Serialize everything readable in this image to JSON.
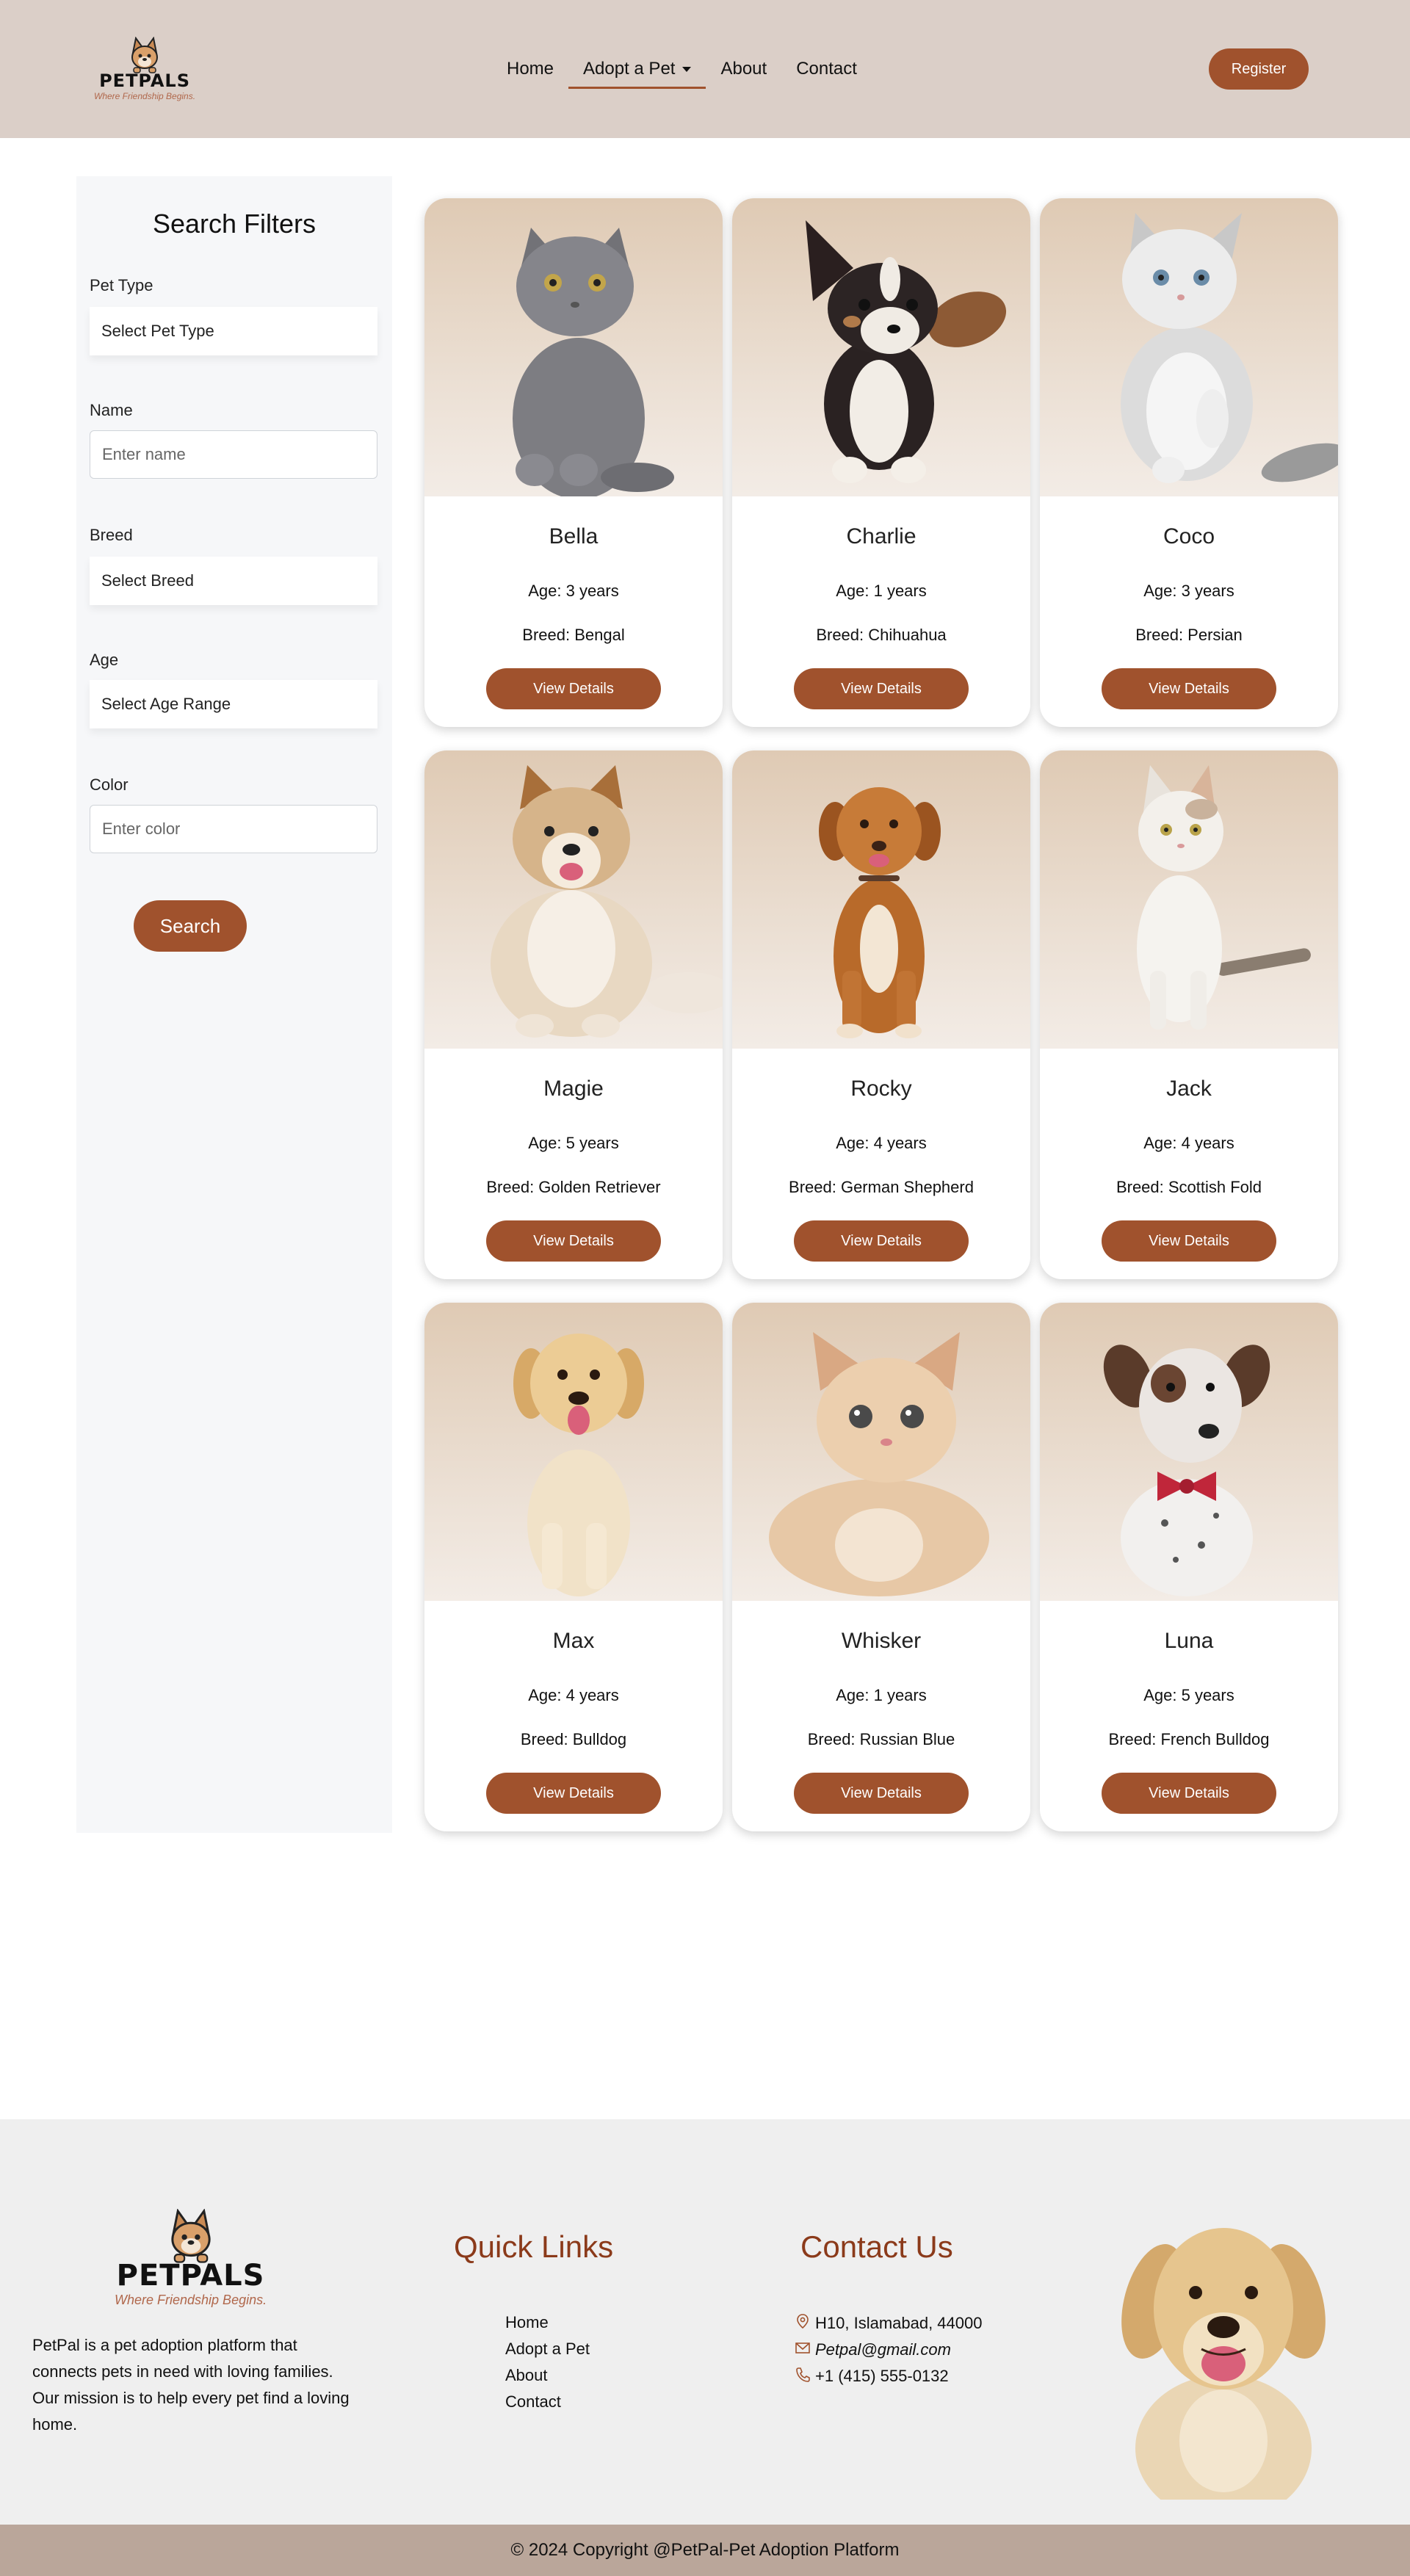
{
  "colors": {
    "accent": "#a0522d",
    "header_bg": "#dbcfc8",
    "footer_bg": "#efefef",
    "copyright_bg": "#baa69a",
    "heading_brown": "#8b3a1a"
  },
  "brand": {
    "name": "PETPALS",
    "tagline": "Where Friendship Begins."
  },
  "nav": {
    "items": [
      {
        "label": "Home"
      },
      {
        "label": "Adopt a Pet"
      },
      {
        "label": "About"
      },
      {
        "label": "Contact"
      }
    ],
    "register_label": "Register"
  },
  "filters": {
    "title": "Search Filters",
    "pet_type": {
      "label": "Pet Type",
      "value": "Select Pet Type"
    },
    "name": {
      "label": "Name",
      "placeholder": "Enter name"
    },
    "breed": {
      "label": "Breed",
      "value": "Select Breed"
    },
    "age": {
      "label": "Age",
      "value": "Select Age Range"
    },
    "color": {
      "label": "Color",
      "placeholder": "Enter color"
    },
    "search_label": "Search"
  },
  "pets": [
    {
      "name": "Bella",
      "age": "Age: 3 years",
      "breed": "Breed: Bengal",
      "button": "View Details"
    },
    {
      "name": "Charlie",
      "age": "Age: 1 years",
      "breed": "Breed: Chihuahua",
      "button": "View Details"
    },
    {
      "name": "Coco",
      "age": "Age: 3 years",
      "breed": "Breed: Persian",
      "button": "View Details"
    },
    {
      "name": "Magie",
      "age": "Age: 5 years",
      "breed": "Breed: Golden Retriever",
      "button": "View Details"
    },
    {
      "name": "Rocky",
      "age": "Age: 4 years",
      "breed": "Breed: German Shepherd",
      "button": "View Details"
    },
    {
      "name": "Jack",
      "age": "Age: 4 years",
      "breed": "Breed: Scottish Fold",
      "button": "View Details"
    },
    {
      "name": "Max",
      "age": "Age: 4 years",
      "breed": "Breed: Bulldog",
      "button": "View Details"
    },
    {
      "name": "Whisker",
      "age": "Age: 1 years",
      "breed": "Breed: Russian Blue",
      "button": "View Details"
    },
    {
      "name": "Luna",
      "age": "Age: 5 years",
      "breed": "Breed: French Bulldog",
      "button": "View Details"
    }
  ],
  "footer": {
    "about": "PetPal is a pet adoption platform that connects pets in need with loving families. Our mission is to help every pet find a loving home.",
    "quick_links_title": "Quick Links",
    "quick_links": [
      "Home",
      "Adopt a Pet",
      "About",
      "Contact"
    ],
    "contact_title": "Contact Us",
    "address": "H10, Islamabad, 44000",
    "email": "Petpal@gmail.com",
    "phone": "+1 (415) 555-0132",
    "copyright": "© 2024 Copyright @PetPal-Pet Adoption Platform"
  }
}
